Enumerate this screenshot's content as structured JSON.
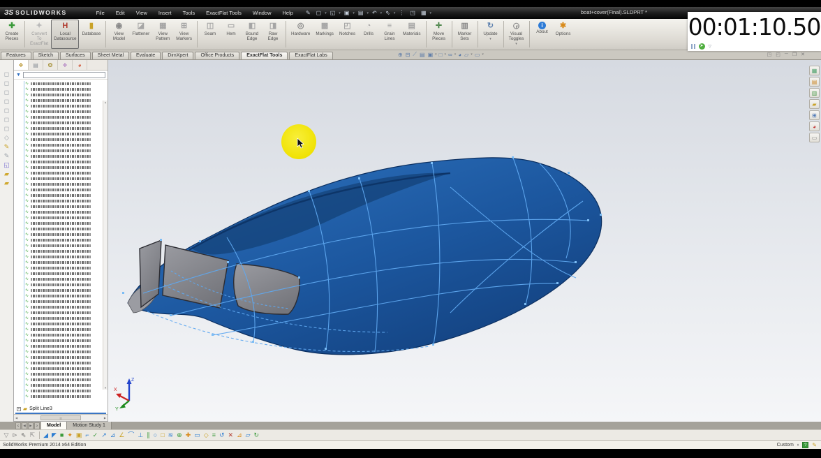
{
  "titlebar": {
    "logo_prefix": "ЗS",
    "logo_text": "SOLIDWORKS",
    "menus": [
      "File",
      "Edit",
      "View",
      "Insert",
      "Tools",
      "ExactFlat Tools",
      "Window",
      "Help"
    ],
    "quick_icons": [
      {
        "name": "pen-icon",
        "glyph": "✎"
      },
      {
        "name": "new-document-icon",
        "glyph": "▢",
        "dropdown": true
      },
      {
        "name": "open-icon",
        "glyph": "◱",
        "dropdown": true
      },
      {
        "name": "save-icon",
        "glyph": "▣",
        "dropdown": true
      },
      {
        "name": "print-icon",
        "glyph": "▤",
        "dropdown": true
      },
      {
        "name": "undo-icon",
        "glyph": "↶",
        "dropdown": true
      },
      {
        "name": "select-icon",
        "glyph": "⇖",
        "dropdown": true
      },
      {
        "name": "rebuild-icon",
        "glyph": "⋮"
      },
      {
        "name": "file-properties-icon",
        "glyph": "◳"
      },
      {
        "name": "view-settings-icon",
        "glyph": "▦",
        "dropdown": true
      }
    ],
    "document_title": "boat+cover(Final).SLDPRT *"
  },
  "timer": {
    "display": "00:01:10.50",
    "start_glyph": "➤",
    "dropdown_glyph": "▽"
  },
  "commandbar": {
    "groups": [
      {
        "buttons": [
          {
            "name": "create-pieces-button",
            "lines": [
              "Create",
              "Pieces"
            ],
            "icon": "✚",
            "icon_color": "#3a9a3a"
          }
        ]
      },
      {
        "buttons": [
          {
            "name": "convert-to-exactflat-button",
            "lines": [
              "Convert",
              "To",
              "ExactFlat"
            ],
            "icon": "✦",
            "icon_color": "#b9b9b9",
            "disabled": true
          },
          {
            "name": "local-datasource-button",
            "lines": [
              "Local",
              "Datasource"
            ],
            "icon": "H",
            "icon_color": "#b03a2e",
            "selected": true
          },
          {
            "name": "database-button",
            "lines": [
              "Database"
            ],
            "icon": "▮",
            "icon_color": "#c9a227"
          }
        ]
      },
      {
        "buttons": [
          {
            "name": "view-model-button",
            "lines": [
              "View",
              "Model"
            ],
            "icon": "◉",
            "icon_color": "#8a8a8a"
          },
          {
            "name": "flattener-button",
            "lines": [
              "Flattener"
            ],
            "icon": "◪",
            "icon_color": "#a5a5a5"
          },
          {
            "name": "view-pattern-button",
            "lines": [
              "View",
              "Pattern"
            ],
            "icon": "▦",
            "icon_color": "#a5a5a5"
          },
          {
            "name": "view-markers-button",
            "lines": [
              "View",
              "Markers"
            ],
            "icon": "⊞",
            "icon_color": "#a5a5a5"
          }
        ]
      },
      {
        "buttons": [
          {
            "name": "seam-button",
            "lines": [
              "Seam"
            ],
            "icon": "◫",
            "icon_color": "#a5a5a5"
          },
          {
            "name": "hem-button",
            "lines": [
              "Hem"
            ],
            "icon": "▭",
            "icon_color": "#a5a5a5"
          },
          {
            "name": "bound-edge-button",
            "lines": [
              "Bound",
              "Edge"
            ],
            "icon": "◧",
            "icon_color": "#a5a5a5"
          },
          {
            "name": "raw-edge-button",
            "lines": [
              "Raw",
              "Edge"
            ],
            "icon": "◨",
            "icon_color": "#a5a5a5"
          }
        ]
      },
      {
        "buttons": [
          {
            "name": "hardware-button",
            "lines": [
              "Hardware"
            ],
            "icon": "◎",
            "icon_color": "#8a8a8a"
          },
          {
            "name": "markings-button",
            "lines": [
              "Markings"
            ],
            "icon": "▩",
            "icon_color": "#a5a5a5"
          },
          {
            "name": "notches-button",
            "lines": [
              "Notches"
            ],
            "icon": "◰",
            "icon_color": "#a5a5a5"
          },
          {
            "name": "drills-button",
            "lines": [
              "Drills"
            ],
            "icon": "◔",
            "icon_color": "#a5a5a5"
          },
          {
            "name": "grain-lines-button",
            "lines": [
              "Grain",
              "Lines"
            ],
            "icon": "≡",
            "icon_color": "#a5a5a5"
          },
          {
            "name": "materials-button",
            "lines": [
              "Materials"
            ],
            "icon": "▤",
            "icon_color": "#a5a5a5"
          }
        ]
      },
      {
        "buttons": [
          {
            "name": "move-pieces-button",
            "lines": [
              "Move",
              "Pieces"
            ],
            "icon": "✛",
            "icon_color": "#3a7a3a"
          }
        ]
      },
      {
        "buttons": [
          {
            "name": "marker-sets-button",
            "lines": [
              "Marker",
              "Sets"
            ],
            "icon": "▥",
            "icon_color": "#8a8a8a"
          }
        ]
      },
      {
        "buttons": [
          {
            "name": "update-button",
            "lines": [
              "Update"
            ],
            "icon": "↻",
            "icon_color": "#5b7fae",
            "dropdown": true
          }
        ]
      },
      {
        "buttons": [
          {
            "name": "visual-toggles-button",
            "lines": [
              "Visual",
              "Toggles"
            ],
            "icon": "◶",
            "icon_color": "#8a8a8a",
            "dropdown": true
          }
        ]
      },
      {
        "buttons": [
          {
            "name": "about-button",
            "lines": [
              "About"
            ],
            "icon": "i",
            "icon_color": "#ffffff",
            "about": true
          },
          {
            "name": "options-button",
            "lines": [
              "Options"
            ],
            "icon": "✱",
            "icon_color": "#d88a1a"
          }
        ]
      }
    ]
  },
  "ribbon_tabs": {
    "items": [
      {
        "label": "Features"
      },
      {
        "label": "Sketch"
      },
      {
        "label": "Surfaces"
      },
      {
        "label": "Sheet Metal"
      },
      {
        "label": "Evaluate"
      },
      {
        "label": "DimXpert"
      },
      {
        "label": "Office Products"
      },
      {
        "label": "ExactFlat Tools",
        "active": true
      },
      {
        "label": "ExactFlat Labs"
      }
    ]
  },
  "headsup": {
    "icons": [
      {
        "name": "zoom-to-fit-icon",
        "glyph": "⊕"
      },
      {
        "name": "zoom-to-area-icon",
        "glyph": "⊟"
      },
      {
        "name": "section-view-icon",
        "glyph": "⟋"
      },
      {
        "name": "previous-view-icon",
        "glyph": "▤"
      },
      {
        "name": "view-orientation-icon",
        "glyph": "▣",
        "dropdown": true
      },
      {
        "name": "display-style-icon",
        "glyph": "□",
        "dropdown": true
      },
      {
        "name": "hide-show-items-icon",
        "glyph": "∞",
        "dropdown": true
      },
      {
        "name": "edit-appearance-icon",
        "glyph": "◕"
      },
      {
        "name": "apply-scene-icon",
        "glyph": "▱",
        "dropdown": true
      },
      {
        "name": "view-settings-icon",
        "glyph": "▭",
        "dropdown": true
      }
    ]
  },
  "window_controls": {
    "icons": [
      {
        "name": "tile-icon",
        "glyph": "◳"
      },
      {
        "name": "cascade-icon",
        "glyph": "◰"
      },
      {
        "name": "minimize-icon",
        "glyph": "─"
      },
      {
        "name": "restore-icon",
        "glyph": "❐"
      },
      {
        "name": "close-icon",
        "glyph": "✕"
      }
    ]
  },
  "left_strip": {
    "icons": [
      {
        "name": "view-cube-front-icon",
        "glyph": "◻",
        "color": "#9aa0a8"
      },
      {
        "name": "view-cube-back-icon",
        "glyph": "◻",
        "color": "#9aa0a8"
      },
      {
        "name": "view-cube-left-icon",
        "glyph": "◻",
        "color": "#9aa0a8"
      },
      {
        "name": "view-cube-right-icon",
        "glyph": "◻",
        "color": "#9aa0a8"
      },
      {
        "name": "view-cube-top-icon",
        "glyph": "◻",
        "color": "#9aa0a8"
      },
      {
        "name": "view-cube-bottom-icon",
        "glyph": "◻",
        "color": "#9aa0a8"
      },
      {
        "name": "view-cube-iso-icon",
        "glyph": "◻",
        "color": "#9aa0a8"
      },
      {
        "name": "view-cube-dimetric-icon",
        "glyph": "◇",
        "color": "#9aa0a8"
      },
      {
        "name": "sketch-icon",
        "glyph": "✎",
        "color": "#c9a227"
      },
      {
        "name": "sketch-3d-icon",
        "glyph": "✎",
        "color": "#9aa0a8"
      },
      {
        "name": "plane-icon",
        "glyph": "◱",
        "color": "#7a6fd0"
      },
      {
        "name": "folder-icon",
        "glyph": "▰",
        "color": "#d0a82e"
      },
      {
        "name": "folder2-icon",
        "glyph": "▰",
        "color": "#d0a82e"
      }
    ]
  },
  "feature_panel": {
    "tabs": [
      {
        "name": "featuremanager-tab",
        "glyph": "❖",
        "color": "#b8952f",
        "active": true
      },
      {
        "name": "propertymanager-tab",
        "glyph": "▤",
        "color": "#8a8f96"
      },
      {
        "name": "configurationmanager-tab",
        "glyph": "❂",
        "color": "#a0892a"
      },
      {
        "name": "dimxpertmanager-tab",
        "glyph": "✛",
        "color": "#9b59b6"
      },
      {
        "name": "displaymanager-tab",
        "glyph": "◕",
        "color": "#cc4422"
      }
    ],
    "filter_funnel_glyph": "▼",
    "tree": {
      "row_count": 57,
      "row_icon_glyph": "∿",
      "last_item_label": "Split Line3"
    }
  },
  "bottom_tabs": {
    "nav_glyphs": [
      "≤",
      "◀",
      "▶",
      "≥"
    ],
    "items": [
      {
        "label": "Model",
        "active": true
      },
      {
        "label": "Motion Study 1"
      }
    ]
  },
  "sketchbar": {
    "gray_icons": [
      {
        "name": "filter-icon",
        "glyph": "▽",
        "color": "#8a8a8a"
      },
      {
        "name": "select-filter-icon",
        "glyph": "⊳",
        "color": "#8a8a8a"
      },
      {
        "name": "pointer-icon",
        "glyph": "⇖",
        "color": "#555555"
      },
      {
        "name": "pointer-drag-icon",
        "glyph": "⇱",
        "color": "#8a8a8a"
      }
    ],
    "tool_icons": [
      {
        "name": "sketch-tool-icon",
        "glyph": "◢",
        "color": "#2d7dd2"
      },
      {
        "name": "sketch-tool-icon",
        "glyph": "◤",
        "color": "#2d7dd2"
      },
      {
        "name": "sketch-tool-icon",
        "glyph": "■",
        "color": "#3a9a3a"
      },
      {
        "name": "sketch-tool-icon",
        "glyph": "✦",
        "color": "#d88a1a"
      },
      {
        "name": "sketch-tool-icon",
        "glyph": "▣",
        "color": "#c9a227"
      },
      {
        "name": "sketch-tool-icon",
        "glyph": "⌐",
        "color": "#2d7dd2"
      },
      {
        "name": "sketch-tool-icon",
        "glyph": "✓",
        "color": "#3a9a3a"
      },
      {
        "name": "sketch-tool-icon",
        "glyph": "↗",
        "color": "#2d7dd2"
      },
      {
        "name": "sketch-tool-icon",
        "glyph": "⊿",
        "color": "#2d7dd2"
      },
      {
        "name": "sketch-tool-icon",
        "glyph": "∠",
        "color": "#c9a227"
      },
      {
        "name": "sketch-tool-icon",
        "glyph": "⌒",
        "color": "#2d7dd2"
      },
      {
        "name": "sketch-tool-icon",
        "glyph": "⊥",
        "color": "#2d7dd2"
      },
      {
        "name": "sketch-tool-icon",
        "glyph": "∥",
        "color": "#3a9a3a"
      },
      {
        "name": "sketch-tool-icon",
        "glyph": "○",
        "color": "#2d7dd2"
      },
      {
        "name": "sketch-tool-icon",
        "glyph": "□",
        "color": "#c9a227"
      },
      {
        "name": "sketch-tool-icon",
        "glyph": "≋",
        "color": "#2d7dd2"
      },
      {
        "name": "sketch-tool-icon",
        "glyph": "⊕",
        "color": "#3a9a3a"
      },
      {
        "name": "sketch-tool-icon",
        "glyph": "✚",
        "color": "#d88a1a"
      },
      {
        "name": "sketch-tool-icon",
        "glyph": "▭",
        "color": "#2d7dd2"
      },
      {
        "name": "sketch-tool-icon",
        "glyph": "◇",
        "color": "#c9a227"
      },
      {
        "name": "sketch-tool-icon",
        "glyph": "≡",
        "color": "#3a9a3a"
      },
      {
        "name": "sketch-tool-icon",
        "glyph": "↺",
        "color": "#2d7dd2"
      },
      {
        "name": "sketch-tool-icon",
        "glyph": "✕",
        "color": "#b03a2e"
      },
      {
        "name": "sketch-tool-icon",
        "glyph": "⊿",
        "color": "#d88a1a"
      },
      {
        "name": "sketch-tool-icon",
        "glyph": "▱",
        "color": "#2d7dd2"
      },
      {
        "name": "sketch-tool-icon",
        "glyph": "↻",
        "color": "#3a9a3a"
      }
    ]
  },
  "statusbar": {
    "left_text": "SolidWorks Premium 2014 x64 Edition",
    "unit_label": "Custom",
    "help_glyph": "?",
    "note_glyph": "✎"
  },
  "viewport": {
    "triad": {
      "x_label": "X",
      "y_label": "Y",
      "z_label": "Z",
      "x_color": "#cc2222",
      "y_color": "#1d8a1d",
      "z_color": "#2244cc"
    },
    "right_toolbar": [
      {
        "name": "exactflat-panel-icon",
        "glyph": "▦",
        "color": "#4aa06a"
      },
      {
        "name": "cost-report-icon",
        "glyph": "▤",
        "color": "#cc8a2a"
      },
      {
        "name": "stats-icon",
        "glyph": "▥",
        "color": "#4a9a4a"
      },
      {
        "name": "library-icon",
        "glyph": "▰",
        "color": "#c9a227"
      },
      {
        "name": "grid-icon",
        "glyph": "⊞",
        "color": "#3a6ab0"
      },
      {
        "name": "appearance-icon",
        "glyph": "◕",
        "color": "#c03a3a"
      },
      {
        "name": "notes-icon",
        "glyph": "▭",
        "color": "#888888"
      }
    ]
  },
  "model": {
    "surface_color": "#2a6cb5",
    "surface_dark_color": "#123f7c",
    "edge_color": "#5fa8f0",
    "window_color": "#8b8c92",
    "highlight_color": "#f0e204"
  }
}
